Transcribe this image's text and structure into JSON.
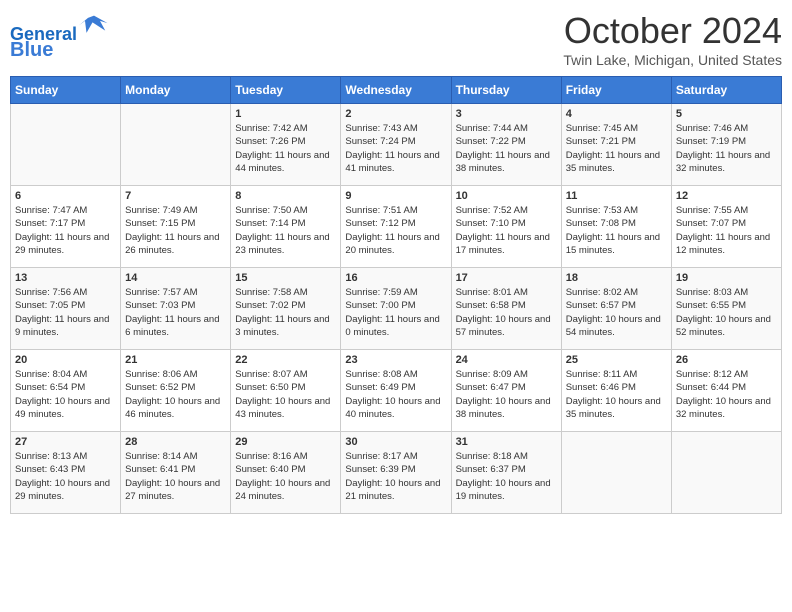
{
  "header": {
    "logo_line1": "General",
    "logo_line2": "Blue",
    "month": "October 2024",
    "location": "Twin Lake, Michigan, United States"
  },
  "days_of_week": [
    "Sunday",
    "Monday",
    "Tuesday",
    "Wednesday",
    "Thursday",
    "Friday",
    "Saturday"
  ],
  "weeks": [
    [
      {
        "day": "",
        "sunrise": "",
        "sunset": "",
        "daylight": ""
      },
      {
        "day": "",
        "sunrise": "",
        "sunset": "",
        "daylight": ""
      },
      {
        "day": "1",
        "sunrise": "Sunrise: 7:42 AM",
        "sunset": "Sunset: 7:26 PM",
        "daylight": "Daylight: 11 hours and 44 minutes."
      },
      {
        "day": "2",
        "sunrise": "Sunrise: 7:43 AM",
        "sunset": "Sunset: 7:24 PM",
        "daylight": "Daylight: 11 hours and 41 minutes."
      },
      {
        "day": "3",
        "sunrise": "Sunrise: 7:44 AM",
        "sunset": "Sunset: 7:22 PM",
        "daylight": "Daylight: 11 hours and 38 minutes."
      },
      {
        "day": "4",
        "sunrise": "Sunrise: 7:45 AM",
        "sunset": "Sunset: 7:21 PM",
        "daylight": "Daylight: 11 hours and 35 minutes."
      },
      {
        "day": "5",
        "sunrise": "Sunrise: 7:46 AM",
        "sunset": "Sunset: 7:19 PM",
        "daylight": "Daylight: 11 hours and 32 minutes."
      }
    ],
    [
      {
        "day": "6",
        "sunrise": "Sunrise: 7:47 AM",
        "sunset": "Sunset: 7:17 PM",
        "daylight": "Daylight: 11 hours and 29 minutes."
      },
      {
        "day": "7",
        "sunrise": "Sunrise: 7:49 AM",
        "sunset": "Sunset: 7:15 PM",
        "daylight": "Daylight: 11 hours and 26 minutes."
      },
      {
        "day": "8",
        "sunrise": "Sunrise: 7:50 AM",
        "sunset": "Sunset: 7:14 PM",
        "daylight": "Daylight: 11 hours and 23 minutes."
      },
      {
        "day": "9",
        "sunrise": "Sunrise: 7:51 AM",
        "sunset": "Sunset: 7:12 PM",
        "daylight": "Daylight: 11 hours and 20 minutes."
      },
      {
        "day": "10",
        "sunrise": "Sunrise: 7:52 AM",
        "sunset": "Sunset: 7:10 PM",
        "daylight": "Daylight: 11 hours and 17 minutes."
      },
      {
        "day": "11",
        "sunrise": "Sunrise: 7:53 AM",
        "sunset": "Sunset: 7:08 PM",
        "daylight": "Daylight: 11 hours and 15 minutes."
      },
      {
        "day": "12",
        "sunrise": "Sunrise: 7:55 AM",
        "sunset": "Sunset: 7:07 PM",
        "daylight": "Daylight: 11 hours and 12 minutes."
      }
    ],
    [
      {
        "day": "13",
        "sunrise": "Sunrise: 7:56 AM",
        "sunset": "Sunset: 7:05 PM",
        "daylight": "Daylight: 11 hours and 9 minutes."
      },
      {
        "day": "14",
        "sunrise": "Sunrise: 7:57 AM",
        "sunset": "Sunset: 7:03 PM",
        "daylight": "Daylight: 11 hours and 6 minutes."
      },
      {
        "day": "15",
        "sunrise": "Sunrise: 7:58 AM",
        "sunset": "Sunset: 7:02 PM",
        "daylight": "Daylight: 11 hours and 3 minutes."
      },
      {
        "day": "16",
        "sunrise": "Sunrise: 7:59 AM",
        "sunset": "Sunset: 7:00 PM",
        "daylight": "Daylight: 11 hours and 0 minutes."
      },
      {
        "day": "17",
        "sunrise": "Sunrise: 8:01 AM",
        "sunset": "Sunset: 6:58 PM",
        "daylight": "Daylight: 10 hours and 57 minutes."
      },
      {
        "day": "18",
        "sunrise": "Sunrise: 8:02 AM",
        "sunset": "Sunset: 6:57 PM",
        "daylight": "Daylight: 10 hours and 54 minutes."
      },
      {
        "day": "19",
        "sunrise": "Sunrise: 8:03 AM",
        "sunset": "Sunset: 6:55 PM",
        "daylight": "Daylight: 10 hours and 52 minutes."
      }
    ],
    [
      {
        "day": "20",
        "sunrise": "Sunrise: 8:04 AM",
        "sunset": "Sunset: 6:54 PM",
        "daylight": "Daylight: 10 hours and 49 minutes."
      },
      {
        "day": "21",
        "sunrise": "Sunrise: 8:06 AM",
        "sunset": "Sunset: 6:52 PM",
        "daylight": "Daylight: 10 hours and 46 minutes."
      },
      {
        "day": "22",
        "sunrise": "Sunrise: 8:07 AM",
        "sunset": "Sunset: 6:50 PM",
        "daylight": "Daylight: 10 hours and 43 minutes."
      },
      {
        "day": "23",
        "sunrise": "Sunrise: 8:08 AM",
        "sunset": "Sunset: 6:49 PM",
        "daylight": "Daylight: 10 hours and 40 minutes."
      },
      {
        "day": "24",
        "sunrise": "Sunrise: 8:09 AM",
        "sunset": "Sunset: 6:47 PM",
        "daylight": "Daylight: 10 hours and 38 minutes."
      },
      {
        "day": "25",
        "sunrise": "Sunrise: 8:11 AM",
        "sunset": "Sunset: 6:46 PM",
        "daylight": "Daylight: 10 hours and 35 minutes."
      },
      {
        "day": "26",
        "sunrise": "Sunrise: 8:12 AM",
        "sunset": "Sunset: 6:44 PM",
        "daylight": "Daylight: 10 hours and 32 minutes."
      }
    ],
    [
      {
        "day": "27",
        "sunrise": "Sunrise: 8:13 AM",
        "sunset": "Sunset: 6:43 PM",
        "daylight": "Daylight: 10 hours and 29 minutes."
      },
      {
        "day": "28",
        "sunrise": "Sunrise: 8:14 AM",
        "sunset": "Sunset: 6:41 PM",
        "daylight": "Daylight: 10 hours and 27 minutes."
      },
      {
        "day": "29",
        "sunrise": "Sunrise: 8:16 AM",
        "sunset": "Sunset: 6:40 PM",
        "daylight": "Daylight: 10 hours and 24 minutes."
      },
      {
        "day": "30",
        "sunrise": "Sunrise: 8:17 AM",
        "sunset": "Sunset: 6:39 PM",
        "daylight": "Daylight: 10 hours and 21 minutes."
      },
      {
        "day": "31",
        "sunrise": "Sunrise: 8:18 AM",
        "sunset": "Sunset: 6:37 PM",
        "daylight": "Daylight: 10 hours and 19 minutes."
      },
      {
        "day": "",
        "sunrise": "",
        "sunset": "",
        "daylight": ""
      },
      {
        "day": "",
        "sunrise": "",
        "sunset": "",
        "daylight": ""
      }
    ]
  ]
}
